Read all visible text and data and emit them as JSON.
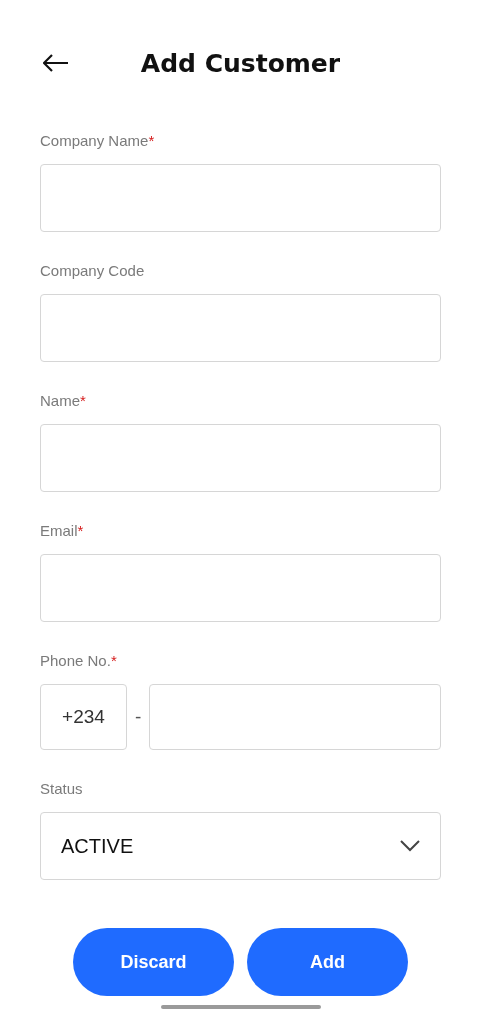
{
  "header": {
    "title": "Add Customer"
  },
  "fields": [
    {
      "kind": "text",
      "label": "Company Name",
      "marker": "*"
    },
    {
      "kind": "text",
      "label": "Company Code"
    },
    {
      "kind": "text",
      "label": "Name",
      "marker": "*"
    },
    {
      "kind": "text",
      "label": "Email",
      "marker": "*"
    },
    {
      "kind": "phone",
      "label": "Phone No.",
      "marker": "*",
      "code": "+234",
      "separator": "-"
    },
    {
      "kind": "select",
      "label": "Status",
      "value": "ACTIVE"
    }
  ],
  "buttons": [
    "Discard",
    "Add"
  ]
}
